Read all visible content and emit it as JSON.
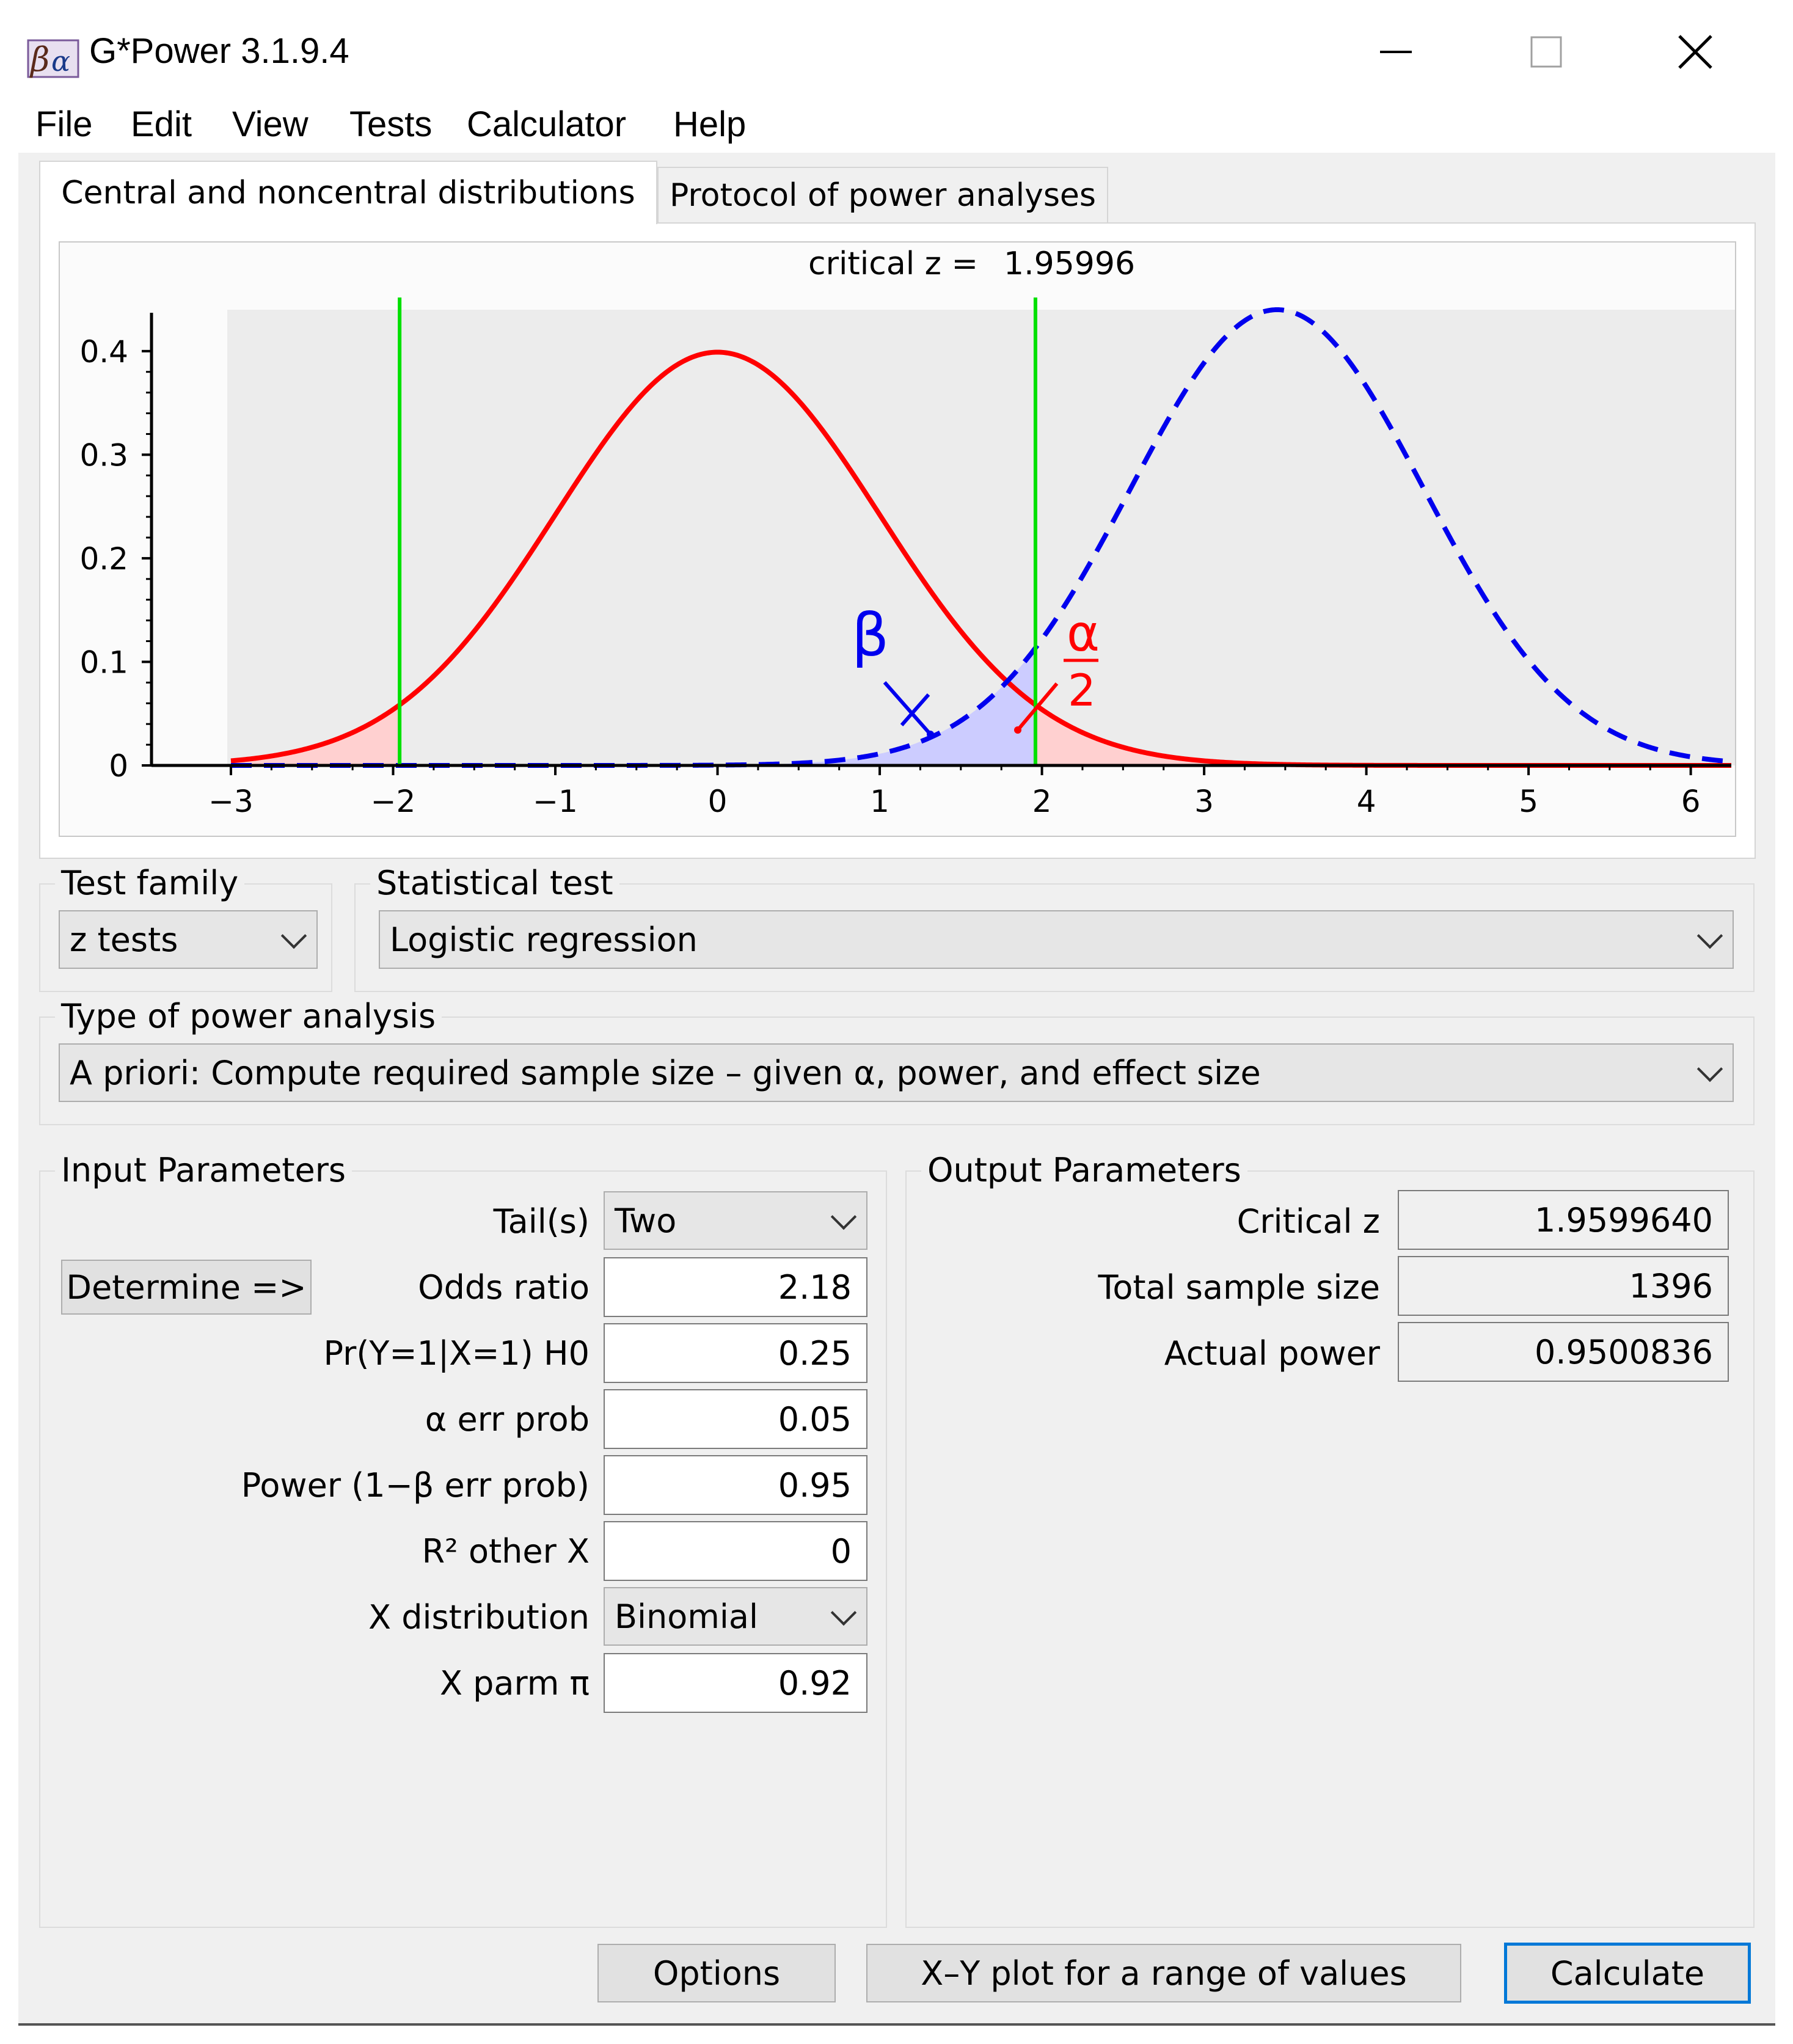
{
  "window": {
    "title": "G*Power 3.1.9.4",
    "icon": "g-power-beta-alpha-icon",
    "controls": [
      "minimize-icon",
      "maximize-icon",
      "close-icon"
    ]
  },
  "menu": [
    "File",
    "Edit",
    "View",
    "Tests",
    "Calculator",
    "Help"
  ],
  "tabs": [
    {
      "label": "Central and noncentral distributions",
      "active": true
    },
    {
      "label": "Protocol of power analyses",
      "active": false
    }
  ],
  "plot": {
    "header_label": "critical z = ",
    "header_value": "1.95996",
    "beta_symbol": "β",
    "alpha_num": "α",
    "alpha_den": "2"
  },
  "chart_data": {
    "type": "line",
    "x_range": [
      -3,
      6.25
    ],
    "ylim": [
      0,
      0.44
    ],
    "x_ticks": [
      "−3",
      "−2",
      "−1",
      "0",
      "1",
      "2",
      "3",
      "4",
      "5",
      "6"
    ],
    "x_tick_values": [
      -3,
      -2,
      -1,
      0,
      1,
      2,
      3,
      4,
      5,
      6
    ],
    "y_ticks": [
      "0",
      "0.1",
      "0.2",
      "0.3",
      "0.4"
    ],
    "y_tick_values": [
      0,
      0.1,
      0.2,
      0.3,
      0.4
    ],
    "critical_lines": [
      -1.95996,
      1.95996
    ],
    "series": [
      {
        "kind": "central",
        "mean": 0,
        "sd": 1,
        "peak": 0.399,
        "color": "#ff0000",
        "style": "solid"
      },
      {
        "kind": "noncentral",
        "mean": 3.45,
        "sd": 0.905,
        "peak": 0.44,
        "color": "#0000ee",
        "style": "dashed"
      }
    ],
    "colors": {
      "critical": "#00e000",
      "alpha_fill": "#ffd0d0",
      "beta_fill": "#ccccff",
      "plot_bg": "#ececec"
    }
  },
  "test_family": {
    "title": "Test family",
    "value": "z tests"
  },
  "statistical_test": {
    "title": "Statistical test",
    "value": "Logistic regression"
  },
  "power_analysis": {
    "title": "Type of power analysis",
    "value": "A priori: Compute required sample size – given α, power, and effect size"
  },
  "input": {
    "title": "Input Parameters",
    "determine_label": "Determine =>",
    "params": [
      {
        "label": "Tail(s)",
        "value": "Two",
        "type": "select"
      },
      {
        "label": "Odds ratio",
        "value": "2.18",
        "type": "input"
      },
      {
        "label": "Pr(Y=1|X=1) H0",
        "value": "0.25",
        "type": "input"
      },
      {
        "label": "α err prob",
        "value": "0.05",
        "type": "input"
      },
      {
        "label": "Power (1−β err prob)",
        "value": "0.95",
        "type": "input"
      },
      {
        "label": "R² other X",
        "value": "0",
        "type": "input"
      },
      {
        "label": "X distribution",
        "value": "Binomial",
        "type": "select"
      },
      {
        "label": "X parm π",
        "value": "0.92",
        "type": "input"
      }
    ]
  },
  "output": {
    "title": "Output Parameters",
    "params": [
      {
        "label": "Critical z",
        "value": "1.9599640"
      },
      {
        "label": "Total sample size",
        "value": "1396"
      },
      {
        "label": "Actual power",
        "value": "0.9500836"
      }
    ]
  },
  "buttons": {
    "options": "Options",
    "xy_plot": "X–Y plot for a range of values",
    "calculate": "Calculate"
  }
}
